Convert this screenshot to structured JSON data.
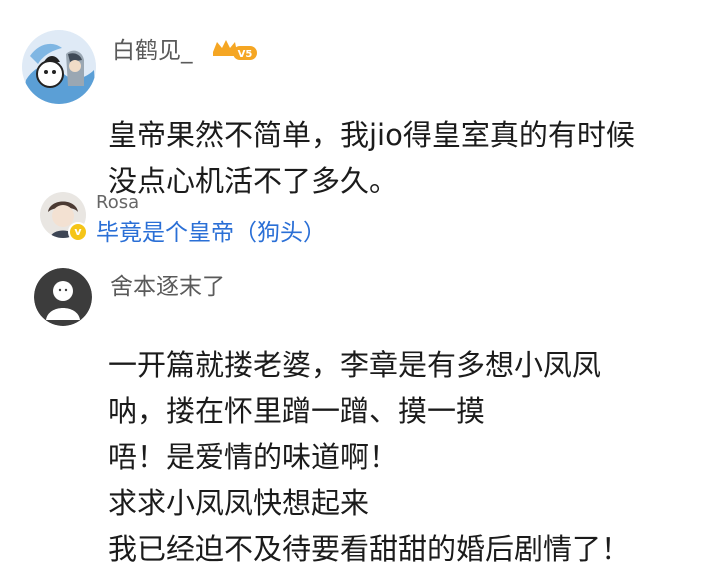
{
  "comment1": {
    "username": "白鹤见_",
    "level_badge": "V5",
    "text_lines": [
      "皇帝果然不简单，我jio得皇室真的有时候",
      "没点心机活不了多久。"
    ],
    "reply": {
      "username": "Rosa",
      "text": "毕竟是个皇帝（狗头）"
    }
  },
  "comment2": {
    "username": "舍本逐末了",
    "text_lines": [
      "一开篇就搂老婆，李章是有多想小凤凤",
      "呐，搂在怀里蹭一蹭、摸一摸",
      "唔！是爱情的味道啊！",
      "求求小凤凤快想起来",
      "我已经迫不及待要看甜甜的婚后剧情了！"
    ]
  },
  "colors": {
    "link_blue": "#2a6fd6",
    "username_gray": "#5a5a5a",
    "badge_orange": "#f5a623"
  }
}
